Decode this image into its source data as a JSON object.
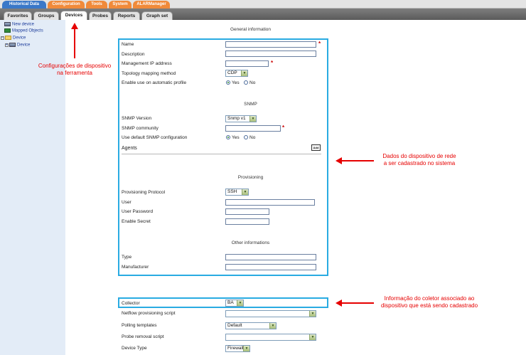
{
  "top_tabs": [
    {
      "label": "Historical Data",
      "color": "#3a78c8"
    },
    {
      "label": "Configuration",
      "color": "#f08a3a"
    },
    {
      "label": "Tools",
      "color": "#f08a3a"
    },
    {
      "label": "System",
      "color": "#f08a3a"
    },
    {
      "label": "ALARManager",
      "color": "#f08a3a"
    }
  ],
  "sub_tabs": [
    {
      "label": "Favorites",
      "active": false
    },
    {
      "label": "Groups",
      "active": false
    },
    {
      "label": "Devices",
      "active": true
    },
    {
      "label": "Probes",
      "active": false
    },
    {
      "label": "Reports",
      "active": false
    },
    {
      "label": "Graph set",
      "active": false
    }
  ],
  "tree": {
    "new_device": "New device",
    "mapped_objects": "Mapped Objects",
    "device_folder": "Device",
    "device_child": "Device"
  },
  "sections": {
    "general": "General information",
    "snmp": "SNMP",
    "provisioning": "Provisioning",
    "other": "Other informations"
  },
  "general": {
    "name_label": "Name",
    "description_label": "Description",
    "mgmt_ip_label": "Management IP address",
    "topology_label": "Topology mapping method",
    "topology_value": "CDP",
    "auto_profile_label": "Enable use on automatic profile",
    "yes": "Yes",
    "no": "No"
  },
  "snmp": {
    "version_label": "SNMP Version",
    "version_value": "Snmp v1",
    "community_label": "SNMP community",
    "default_config_label": "Use default SNMP configuration",
    "yes": "Yes",
    "no": "No",
    "agents_label": "Agents",
    "add_button": "Add"
  },
  "provisioning": {
    "protocol_label": "Provisioning Protocol",
    "protocol_value": "SSH",
    "user_label": "User",
    "password_label": "User Password",
    "enable_secret_label": "Enable Secret"
  },
  "other": {
    "type_label": "Type",
    "manufacturer_label": "Manufacturer"
  },
  "bottom": {
    "collector_label": "Collector",
    "collector_value": "BA",
    "netflow_label": "Netflow provisioning script",
    "netflow_value": "",
    "polling_label": "Polling templates",
    "polling_value": "Default",
    "probe_removal_label": "Probe removal script",
    "probe_removal_value": "",
    "device_type_label": "Device Type",
    "device_type_value": "Firewall"
  },
  "annotations": {
    "config_line1": "Configurações de dispositivo",
    "config_line2": "na ferramenta",
    "device_line1": "Dados do dispositivo de rede",
    "device_line2": "a ser cadastrado no sistema",
    "collector_line1": "Informação do coletor associado ao",
    "collector_line2": "dispositivo que está sendo cadastrado"
  },
  "colors": {
    "highlight": "#29abe2",
    "annotation": "#e60000",
    "required": "#cc0000"
  }
}
